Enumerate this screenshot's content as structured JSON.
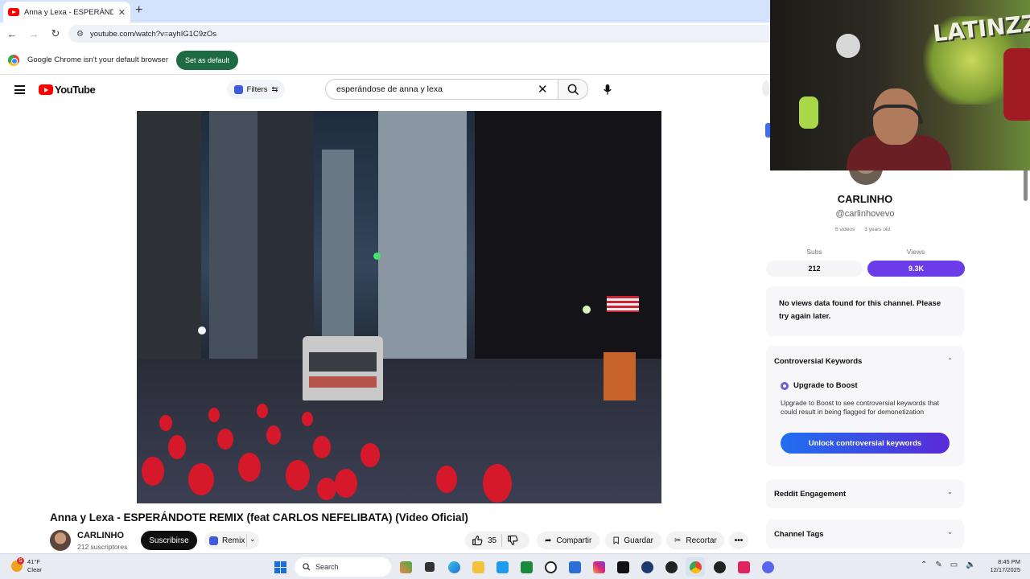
{
  "browser": {
    "tab_title": "Anna y Lexa - ESPERÁNDOTE R",
    "url": "youtube.com/watch?v=ayhIG1C9zOs",
    "infobar_text": "Google Chrome isn't your default browser",
    "set_default_label": "Set as default"
  },
  "youtube": {
    "logo_text": "YouTube",
    "filters_label": "Filters",
    "search_value": "esperándose de anna y lexa"
  },
  "video": {
    "title": "Anna y Lexa - ESPERÁNDOTE REMIX (feat CARLOS NEFELIBATA) (Video Oficial)",
    "channel_name": "CARLINHO",
    "channel_subs": "212 suscriptores",
    "subscribe_label": "Suscribirse",
    "remix_label": "Remix",
    "like_count": "35",
    "share_label": "Compartir",
    "save_label": "Guardar",
    "clip_label": "Recortar",
    "more_label": "•••"
  },
  "panel": {
    "channel_name": "CARLINHO",
    "handle": "@carlinhovevo",
    "videos": "6 videos",
    "age": "3 years old",
    "subs_label": "Subs",
    "subs_value": "212",
    "views_label": "Views",
    "views_value": "9.3K",
    "no_views_msg": "No views data found for this channel. Please try again later.",
    "controversial_title": "Controversial Keywords",
    "upgrade_title": "Upgrade to Boost",
    "upgrade_desc": "Upgrade to Boost to see controversial keywords that could result in being flagged for demonetization",
    "unlock_label": "Unlock controversial keywords",
    "reddit_title": "Reddit Engagement",
    "tags_title": "Channel Tags"
  },
  "webcam": {
    "graffiti_text": "LATINZZ!"
  },
  "taskbar": {
    "notif_count": "5",
    "temp": "41°F",
    "condition": "Clear",
    "search_label": "Search",
    "time": "8:45 PM",
    "date": "12/17/2025"
  }
}
